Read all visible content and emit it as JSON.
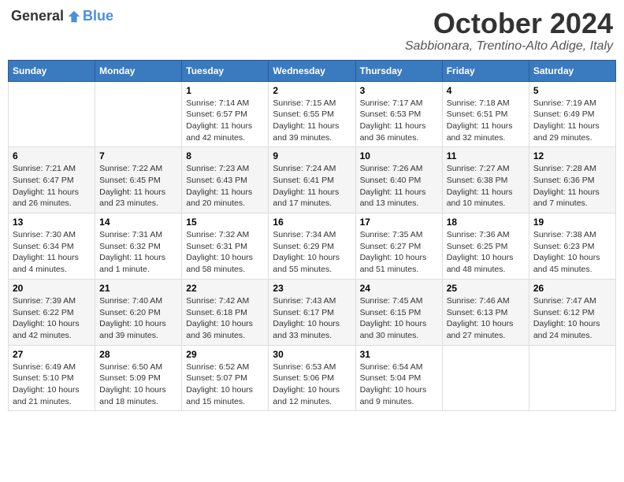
{
  "logo": {
    "text_general": "General",
    "text_blue": "Blue"
  },
  "header": {
    "month": "October 2024",
    "location": "Sabbionara, Trentino-Alto Adige, Italy"
  },
  "weekdays": [
    "Sunday",
    "Monday",
    "Tuesday",
    "Wednesday",
    "Thursday",
    "Friday",
    "Saturday"
  ],
  "weeks": [
    [
      {
        "day": "",
        "info": ""
      },
      {
        "day": "",
        "info": ""
      },
      {
        "day": "1",
        "info": "Sunrise: 7:14 AM\nSunset: 6:57 PM\nDaylight: 11 hours and 42 minutes."
      },
      {
        "day": "2",
        "info": "Sunrise: 7:15 AM\nSunset: 6:55 PM\nDaylight: 11 hours and 39 minutes."
      },
      {
        "day": "3",
        "info": "Sunrise: 7:17 AM\nSunset: 6:53 PM\nDaylight: 11 hours and 36 minutes."
      },
      {
        "day": "4",
        "info": "Sunrise: 7:18 AM\nSunset: 6:51 PM\nDaylight: 11 hours and 32 minutes."
      },
      {
        "day": "5",
        "info": "Sunrise: 7:19 AM\nSunset: 6:49 PM\nDaylight: 11 hours and 29 minutes."
      }
    ],
    [
      {
        "day": "6",
        "info": "Sunrise: 7:21 AM\nSunset: 6:47 PM\nDaylight: 11 hours and 26 minutes."
      },
      {
        "day": "7",
        "info": "Sunrise: 7:22 AM\nSunset: 6:45 PM\nDaylight: 11 hours and 23 minutes."
      },
      {
        "day": "8",
        "info": "Sunrise: 7:23 AM\nSunset: 6:43 PM\nDaylight: 11 hours and 20 minutes."
      },
      {
        "day": "9",
        "info": "Sunrise: 7:24 AM\nSunset: 6:41 PM\nDaylight: 11 hours and 17 minutes."
      },
      {
        "day": "10",
        "info": "Sunrise: 7:26 AM\nSunset: 6:40 PM\nDaylight: 11 hours and 13 minutes."
      },
      {
        "day": "11",
        "info": "Sunrise: 7:27 AM\nSunset: 6:38 PM\nDaylight: 11 hours and 10 minutes."
      },
      {
        "day": "12",
        "info": "Sunrise: 7:28 AM\nSunset: 6:36 PM\nDaylight: 11 hours and 7 minutes."
      }
    ],
    [
      {
        "day": "13",
        "info": "Sunrise: 7:30 AM\nSunset: 6:34 PM\nDaylight: 11 hours and 4 minutes."
      },
      {
        "day": "14",
        "info": "Sunrise: 7:31 AM\nSunset: 6:32 PM\nDaylight: 11 hours and 1 minute."
      },
      {
        "day": "15",
        "info": "Sunrise: 7:32 AM\nSunset: 6:31 PM\nDaylight: 10 hours and 58 minutes."
      },
      {
        "day": "16",
        "info": "Sunrise: 7:34 AM\nSunset: 6:29 PM\nDaylight: 10 hours and 55 minutes."
      },
      {
        "day": "17",
        "info": "Sunrise: 7:35 AM\nSunset: 6:27 PM\nDaylight: 10 hours and 51 minutes."
      },
      {
        "day": "18",
        "info": "Sunrise: 7:36 AM\nSunset: 6:25 PM\nDaylight: 10 hours and 48 minutes."
      },
      {
        "day": "19",
        "info": "Sunrise: 7:38 AM\nSunset: 6:23 PM\nDaylight: 10 hours and 45 minutes."
      }
    ],
    [
      {
        "day": "20",
        "info": "Sunrise: 7:39 AM\nSunset: 6:22 PM\nDaylight: 10 hours and 42 minutes."
      },
      {
        "day": "21",
        "info": "Sunrise: 7:40 AM\nSunset: 6:20 PM\nDaylight: 10 hours and 39 minutes."
      },
      {
        "day": "22",
        "info": "Sunrise: 7:42 AM\nSunset: 6:18 PM\nDaylight: 10 hours and 36 minutes."
      },
      {
        "day": "23",
        "info": "Sunrise: 7:43 AM\nSunset: 6:17 PM\nDaylight: 10 hours and 33 minutes."
      },
      {
        "day": "24",
        "info": "Sunrise: 7:45 AM\nSunset: 6:15 PM\nDaylight: 10 hours and 30 minutes."
      },
      {
        "day": "25",
        "info": "Sunrise: 7:46 AM\nSunset: 6:13 PM\nDaylight: 10 hours and 27 minutes."
      },
      {
        "day": "26",
        "info": "Sunrise: 7:47 AM\nSunset: 6:12 PM\nDaylight: 10 hours and 24 minutes."
      }
    ],
    [
      {
        "day": "27",
        "info": "Sunrise: 6:49 AM\nSunset: 5:10 PM\nDaylight: 10 hours and 21 minutes."
      },
      {
        "day": "28",
        "info": "Sunrise: 6:50 AM\nSunset: 5:09 PM\nDaylight: 10 hours and 18 minutes."
      },
      {
        "day": "29",
        "info": "Sunrise: 6:52 AM\nSunset: 5:07 PM\nDaylight: 10 hours and 15 minutes."
      },
      {
        "day": "30",
        "info": "Sunrise: 6:53 AM\nSunset: 5:06 PM\nDaylight: 10 hours and 12 minutes."
      },
      {
        "day": "31",
        "info": "Sunrise: 6:54 AM\nSunset: 5:04 PM\nDaylight: 10 hours and 9 minutes."
      },
      {
        "day": "",
        "info": ""
      },
      {
        "day": "",
        "info": ""
      }
    ]
  ]
}
